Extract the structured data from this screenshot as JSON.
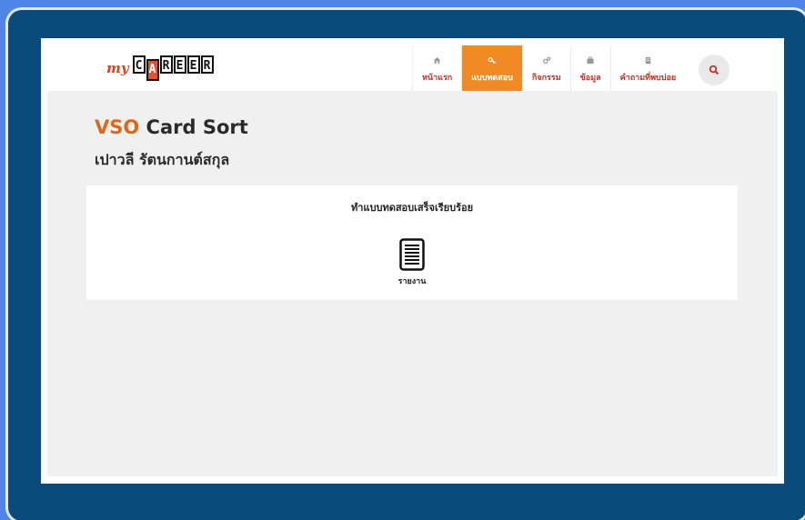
{
  "brand": {
    "prefix": "my",
    "letters": [
      "C",
      "A",
      "R",
      "E",
      "E",
      "R"
    ],
    "accent": "#e8502b"
  },
  "nav": {
    "items": [
      {
        "label": "หน้าแรก",
        "icon": "home-icon",
        "active": false
      },
      {
        "label": "แบบทดสอบ",
        "icon": "key-icon",
        "active": true
      },
      {
        "label": "กิจกรรม",
        "icon": "gears-icon",
        "active": false
      },
      {
        "label": "ข้อมูล",
        "icon": "briefcase-icon",
        "active": false
      },
      {
        "label": "คำถามที่พบบ่อย",
        "icon": "book-icon",
        "active": false
      }
    ],
    "search_icon": "search-icon"
  },
  "page": {
    "title_prefix": "VSO",
    "title_rest": "Card Sort",
    "user_name": "เปาวลี รัตนกานต์สกุล"
  },
  "result": {
    "message": "ทำแบบทดสอบเสร็จเรียบร้อย",
    "report_label": "รายงาน",
    "report_icon": "document-icon"
  },
  "colors": {
    "frame": "#0b4b7c",
    "active_tab": "#f08a24",
    "title_accent": "#e0661a",
    "nav_text": "#c0342a"
  }
}
